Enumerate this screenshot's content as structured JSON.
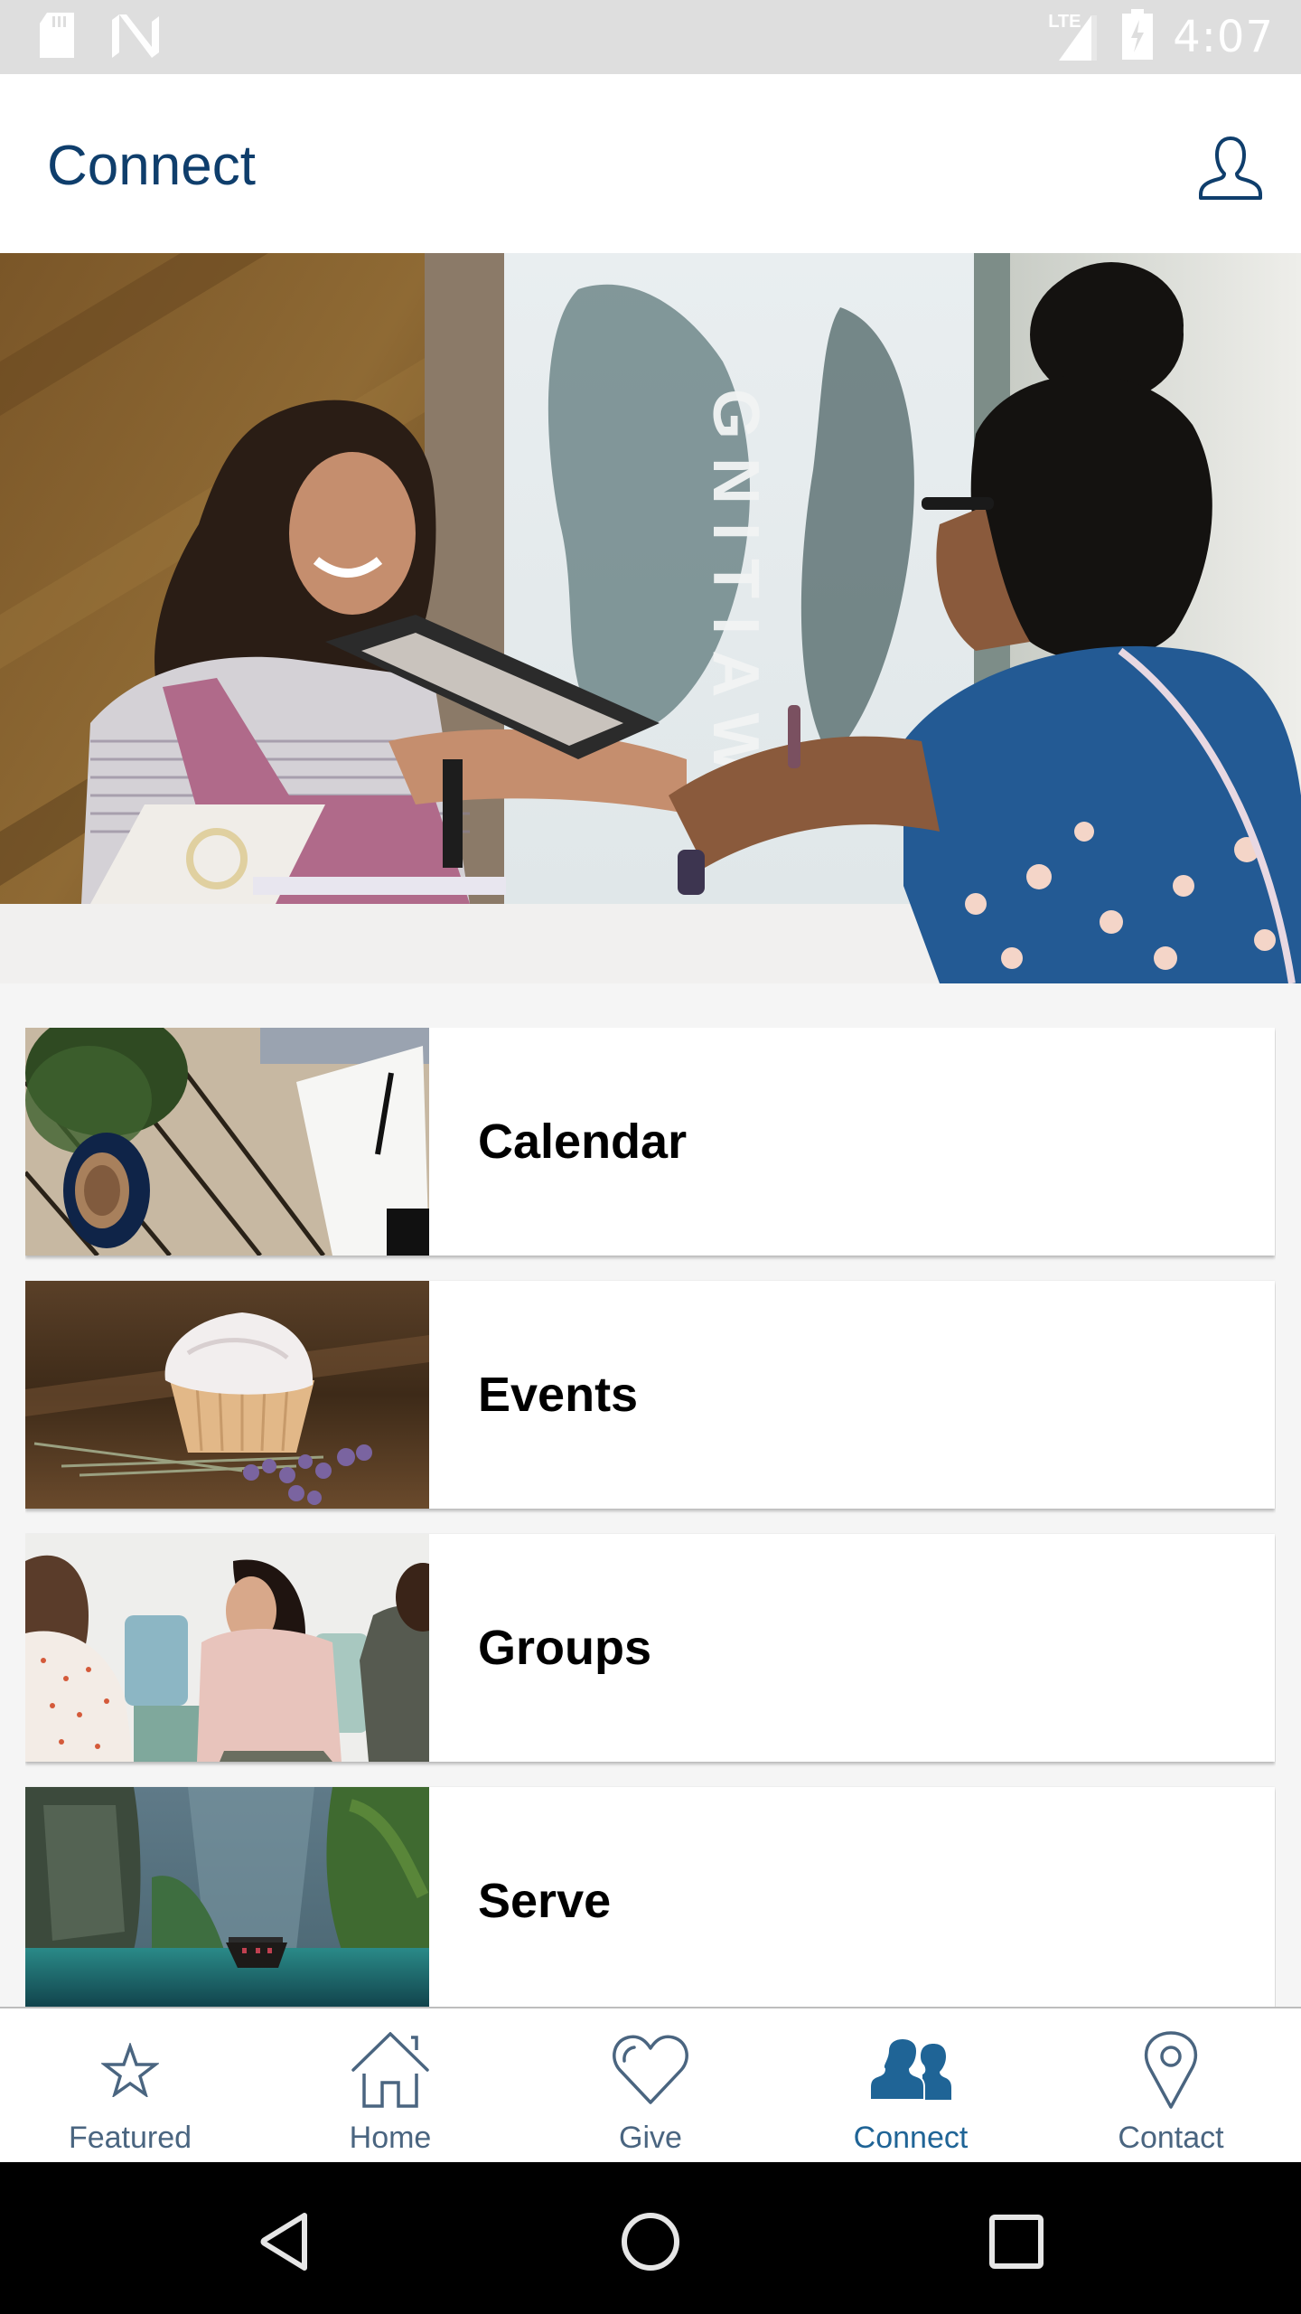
{
  "status_bar": {
    "time": "4:07",
    "network": "LTE",
    "left_icons": [
      "sd-card-icon",
      "n-notification-icon"
    ],
    "right_icons": [
      "lte-signal-icon",
      "battery-charging-icon"
    ]
  },
  "app_bar": {
    "title": "Connect",
    "profile_icon": "user-profile-icon"
  },
  "hero": {
    "description": "Welcome desk photo: two women talking at a check-in kiosk"
  },
  "cards": [
    {
      "title": "Calendar",
      "image": "coffee, notebook and plant on wooden table"
    },
    {
      "title": "Events",
      "image": "cupcake with lavender on wooden table"
    },
    {
      "title": "Groups",
      "image": "friends talking on a sofa"
    },
    {
      "title": "Serve",
      "image": "boat between limestone cliffs"
    }
  ],
  "bottom_nav": {
    "items": [
      {
        "label": "Featured",
        "icon": "star-icon",
        "active": false
      },
      {
        "label": "Home",
        "icon": "home-icon",
        "active": false
      },
      {
        "label": "Give",
        "icon": "heart-icon",
        "active": false
      },
      {
        "label": "Connect",
        "icon": "people-icon",
        "active": true
      },
      {
        "label": "Contact",
        "icon": "map-pin-icon",
        "active": false
      }
    ]
  },
  "colors": {
    "primary": "#0f3e6c",
    "nav_inactive": "#4a6580",
    "nav_active": "#1f6496",
    "status_bar": "#dedede",
    "background": "#f5f5f5"
  },
  "system_nav": {
    "buttons": [
      "back",
      "home",
      "recents"
    ]
  }
}
